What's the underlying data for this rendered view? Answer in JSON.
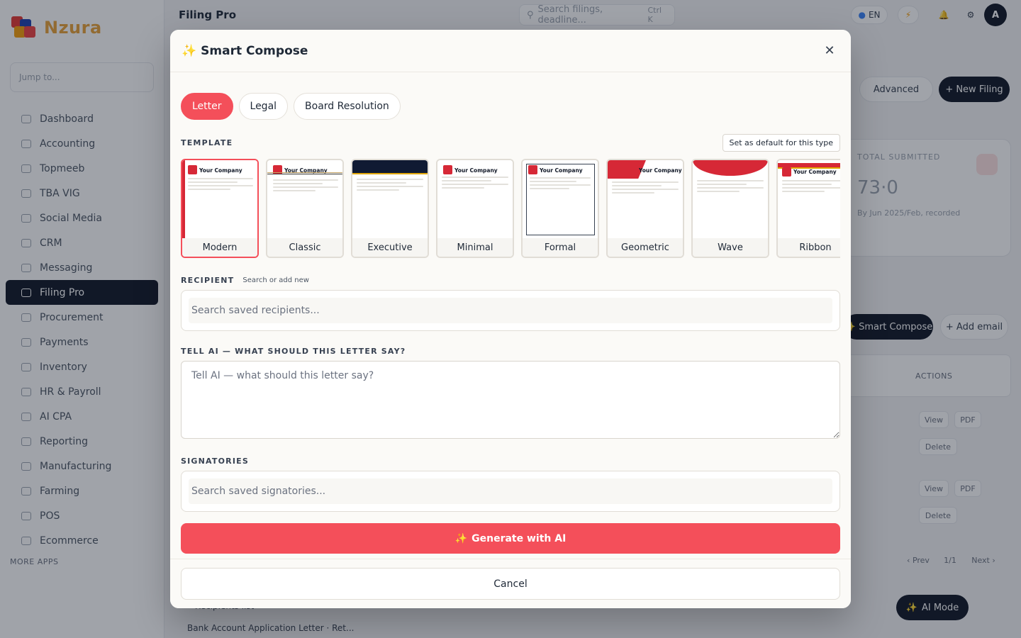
{
  "app": {
    "brand": "Nzura",
    "header_title": "Filing Pro",
    "top_search_placeholder": "Search filings, deadline...",
    "top_search_shortcut": "Ctrl K",
    "language": "EN",
    "avatar_initial": "A",
    "sidebar_search_placeholder": "Jump to...",
    "sidebar_items": [
      {
        "label": "Dashboard"
      },
      {
        "label": "Accounting"
      },
      {
        "label": "Topmeeb"
      },
      {
        "label": "TBA VIG"
      },
      {
        "label": "Social Media"
      },
      {
        "label": "CRM"
      },
      {
        "label": "Messaging"
      },
      {
        "label": "Filing Pro",
        "active": true
      },
      {
        "label": "Procurement"
      },
      {
        "label": "Payments"
      },
      {
        "label": "Inventory"
      },
      {
        "label": "HR & Payroll"
      },
      {
        "label": "AI CPA"
      },
      {
        "label": "Reporting"
      },
      {
        "label": "Manufacturing"
      },
      {
        "label": "Farming"
      },
      {
        "label": "POS"
      },
      {
        "label": "Ecommerce"
      }
    ],
    "sidebar_footer": "MORE APPS",
    "advanced_label": "Advanced",
    "new_filing_label": "+ New Filing",
    "card_label": "TOTAL SUBMITTED",
    "card_value": "73·0",
    "card_sub": "By Jun 2025/Feb, recorded",
    "smart_compose_label": "✨ Smart Compose",
    "add_email_label": "+ Add email",
    "table_header": "ACTIONS",
    "row_actions": [
      "View",
      "PDF",
      "Delete"
    ],
    "pagination": {
      "prev": "‹ Prev",
      "page": "1/1",
      "next": "Next ›"
    },
    "ai_mode_label": "AI Mode",
    "bottom_rows": [
      "• Recipients list",
      "Bank Account Application Letter · Ret..."
    ]
  },
  "modal": {
    "title": "Smart Compose",
    "title_icon": "sparkles-icon",
    "tabs": [
      {
        "label": "Letter",
        "active": true
      },
      {
        "label": "Legal",
        "active": false
      },
      {
        "label": "Board Resolution",
        "active": false
      }
    ],
    "template_section_label": "TEMPLATE",
    "set_default_label": "Set as default for this type",
    "templates": [
      {
        "name": "Modern",
        "selected": true
      },
      {
        "name": "Classic",
        "selected": false
      },
      {
        "name": "Executive",
        "selected": false
      },
      {
        "name": "Minimal",
        "selected": false
      },
      {
        "name": "Formal",
        "selected": false
      },
      {
        "name": "Geometric",
        "selected": false
      },
      {
        "name": "Wave",
        "selected": false
      },
      {
        "name": "Ribbon",
        "selected": false
      }
    ],
    "template_company_text": "Your Company",
    "recipient_label": "RECIPIENT",
    "recipient_hint": "Search or add new",
    "recipient_placeholder": "Search saved recipients...",
    "message_label": "TELL AI — WHAT SHOULD THIS LETTER SAY?",
    "message_placeholder": "Tell AI — what should this letter say?",
    "signatories_label": "SIGNATORIES",
    "signatories_placeholder": "Search saved signatories...",
    "generate_label": "Generate with AI",
    "cancel_label": "Cancel"
  },
  "colors": {
    "accent": "#f44f5a",
    "brand_red": "#d62836",
    "dark": "#111827"
  }
}
